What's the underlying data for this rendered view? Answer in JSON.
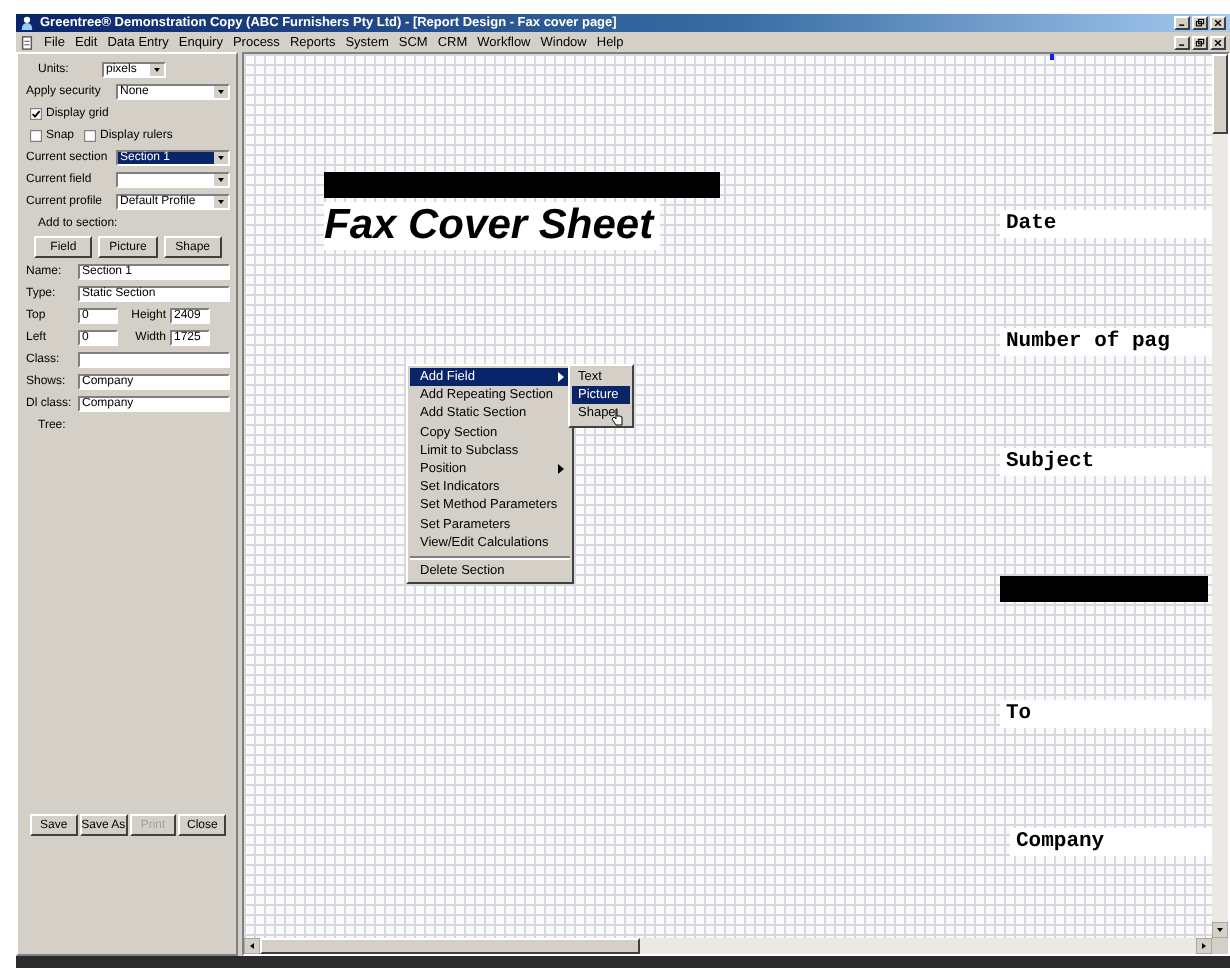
{
  "window": {
    "title": "Greentree® Demonstration Copy (ABC Furnishers Pty Ltd) - [Report Design - Fax cover page]"
  },
  "menu": [
    "File",
    "Edit",
    "Data Entry",
    "Enquiry",
    "Process",
    "Reports",
    "System",
    "SCM",
    "CRM",
    "Workflow",
    "Window",
    "Help"
  ],
  "panel": {
    "rows": [
      {
        "kind": "select-short",
        "label": "Units:",
        "value": "pixels"
      },
      {
        "kind": "select",
        "label": "Apply security",
        "value": "None"
      },
      {
        "kind": "checks",
        "items": [
          {
            "label": "Display grid",
            "checked": true
          }
        ]
      },
      {
        "kind": "checks",
        "items": [
          {
            "label": "Snap",
            "checked": false
          },
          {
            "label": "Display rulers",
            "checked": false
          }
        ]
      },
      {
        "kind": "select",
        "label": "Current section",
        "value": "Section 1",
        "highlighted": true
      },
      {
        "kind": "select",
        "label": "Current field",
        "value": "",
        "highlighted": false
      },
      {
        "kind": "select",
        "label": "Current profile",
        "value": "Default Profile",
        "highlighted": false
      },
      {
        "kind": "caption",
        "text": "Add to section:"
      },
      {
        "kind": "buttons",
        "items": [
          {
            "label": "Field",
            "disabled": false
          },
          {
            "label": "Picture",
            "disabled": false
          },
          {
            "label": "Shape",
            "disabled": false
          }
        ]
      },
      {
        "kind": "field",
        "label": "Name:",
        "value": "Section 1"
      },
      {
        "kind": "field",
        "label": "Type:",
        "value": "Static Section"
      },
      {
        "kind": "pair",
        "fields": [
          {
            "label": "Top",
            "value": "0"
          },
          {
            "label": "Height",
            "value": "2409"
          }
        ]
      },
      {
        "kind": "pair",
        "fields": [
          {
            "label": "Left",
            "value": "0"
          },
          {
            "label": "Width",
            "value": "1725"
          }
        ]
      },
      {
        "kind": "field",
        "label": "Class:",
        "value": ""
      },
      {
        "kind": "field",
        "label": "Shows:",
        "value": "Company"
      },
      {
        "kind": "field",
        "label": "Dl class:",
        "value": "Company"
      },
      {
        "kind": "caption",
        "text": "Tree:"
      }
    ],
    "actions": [
      {
        "label": "Save",
        "disabled": false
      },
      {
        "label": "Save As",
        "disabled": false
      },
      {
        "label": "Print",
        "disabled": true
      },
      {
        "label": "Close",
        "disabled": false
      }
    ]
  },
  "canvas": {
    "elements": [
      {
        "kind": "bar"
      },
      {
        "kind": "heading",
        "text": "Fax Cover Sheet"
      },
      {
        "kind": "field",
        "text": "Date"
      },
      {
        "kind": "field",
        "text": "Number of pag"
      },
      {
        "kind": "field",
        "text": "Subject"
      },
      {
        "kind": "bar"
      },
      {
        "kind": "field",
        "text": "To"
      },
      {
        "kind": "field",
        "text": "Company"
      }
    ],
    "context_menu": {
      "items": [
        {
          "label": "Add Field",
          "submenu": true,
          "highlighted": true,
          "separator_before": false
        },
        {
          "label": "Add Repeating Section",
          "submenu": false,
          "highlighted": false,
          "separator_before": false
        },
        {
          "label": "Add Static Section",
          "submenu": false,
          "highlighted": false,
          "separator_before": false
        },
        {
          "label": "Copy Section",
          "submenu": false,
          "highlighted": false,
          "separator_before": false
        },
        {
          "label": "Limit to Subclass",
          "submenu": false,
          "highlighted": false,
          "separator_before": false
        },
        {
          "label": "Position",
          "submenu": true,
          "highlighted": false,
          "separator_before": false
        },
        {
          "label": "Set Indicators",
          "submenu": false,
          "highlighted": false,
          "separator_before": false
        },
        {
          "label": "Set Method Parameters",
          "submenu": false,
          "highlighted": false,
          "separator_before": false
        },
        {
          "label": "Set Parameters",
          "submenu": false,
          "highlighted": false,
          "separator_before": false
        },
        {
          "label": "View/Edit Calculations",
          "submenu": false,
          "highlighted": false,
          "separator_before": false
        },
        {
          "label": "Delete Section",
          "submenu": false,
          "highlighted": false,
          "separator_before": true
        }
      ],
      "submenu": [
        {
          "label": "Text",
          "selected": false
        },
        {
          "label": "Picture",
          "selected": true
        },
        {
          "label": "Shape",
          "selected": false
        }
      ]
    }
  }
}
